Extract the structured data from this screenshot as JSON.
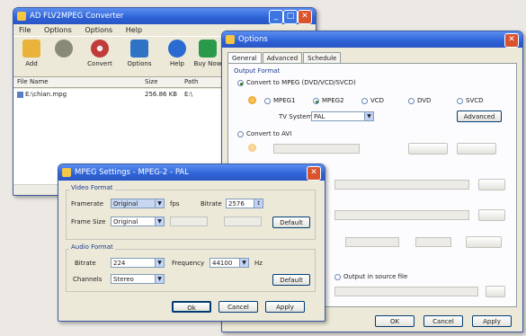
{
  "main_window": {
    "title": "AD FLV2MPEG Converter",
    "menu": [
      "File",
      "Options",
      "Options",
      "Help"
    ],
    "toolbar": [
      {
        "label": "Add",
        "icon": "folder-add-icon",
        "color": "#e9b33a"
      },
      {
        "label": "",
        "icon": "remove-icon",
        "color": "#8a8a7a"
      },
      {
        "label": "Convert",
        "icon": "convert-disc-icon",
        "color": "#c23a3a"
      },
      {
        "label": "Options",
        "icon": "options-icon",
        "color": "#2f73c4"
      },
      {
        "label": "Help",
        "icon": "help-icon",
        "color": "#2b6bd1"
      },
      {
        "label": "Buy Now",
        "icon": "buy-now-icon",
        "color": "#2a9a4a"
      }
    ],
    "columns": [
      "File Name",
      "Size",
      "Path"
    ],
    "rows": [
      {
        "name": "E:\\chian.mpg",
        "size": "256.86 KB",
        "path": "E:\\"
      }
    ]
  },
  "options_dialog": {
    "title": "Options",
    "tabs": [
      "General",
      "Advanced",
      "Schedule"
    ],
    "output_format_label": "Output Format",
    "convert_mpeg_label": "Convert to MPEG (DVD/VCD/SVCD)",
    "mpeg_types": [
      "MPEG1",
      "MPEG2",
      "VCD",
      "DVD",
      "SVCD"
    ],
    "tv_system_label": "TV System:",
    "tv_system_value": "PAL",
    "advanced_button": "Advanced",
    "convert_avi_label": "Convert to AVI",
    "source_file_label": "Output in source file",
    "ok": "OK",
    "cancel": "Cancel",
    "apply": "Apply"
  },
  "mpeg_dialog": {
    "title": "MPEG Settings - MPEG-2 - PAL",
    "video_group": "Video Format",
    "framerate_label": "Framerate",
    "framerate_value": "Original",
    "fps": "fps",
    "bitrate_label": "Bitrate",
    "video_bitrate": "2576",
    "frame_size_label": "Frame Size",
    "frame_size_value": "Original",
    "default_label": "Default",
    "audio_group": "Audio Format",
    "audio_bitrate_label": "Bitrate",
    "audio_bitrate": "224",
    "frequency_label": "Frequency",
    "frequency_value": "44100",
    "hz": "Hz",
    "channels_label": "Channels",
    "channels_value": "Stereo",
    "ok": "Ok",
    "cancel": "Cancel",
    "apply": "Apply"
  }
}
